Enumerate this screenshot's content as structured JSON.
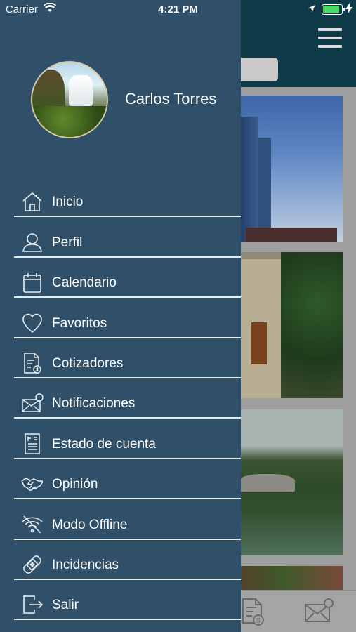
{
  "status_bar": {
    "carrier": "Carrier",
    "time": "4:21 PM",
    "battery_level": 0.9,
    "battery_color": "#4cd964"
  },
  "drawer": {
    "user_name": "Carlos Torres",
    "background_color": "#2f5068",
    "menu": [
      {
        "label": "Inicio",
        "icon": "home-icon"
      },
      {
        "label": "Perfil",
        "icon": "user-icon"
      },
      {
        "label": "Calendario",
        "icon": "calendar-icon"
      },
      {
        "label": "Favoritos",
        "icon": "heart-icon"
      },
      {
        "label": "Cotizadores",
        "icon": "quote-document-icon"
      },
      {
        "label": "Notificaciones",
        "icon": "mail-notification-icon"
      },
      {
        "label": "Estado de cuenta",
        "icon": "account-statement-icon"
      },
      {
        "label": "Opinión",
        "icon": "handshake-icon"
      },
      {
        "label": "Modo Offline",
        "icon": "wifi-off-icon"
      },
      {
        "label": "Incidencias",
        "icon": "bandage-icon"
      },
      {
        "label": "Salir",
        "icon": "logout-icon"
      }
    ]
  },
  "background_app": {
    "header_color": "#0f3a48",
    "tab_bar": [
      {
        "icon": "quote-document-icon"
      },
      {
        "icon": "mail-notification-icon"
      }
    ]
  }
}
